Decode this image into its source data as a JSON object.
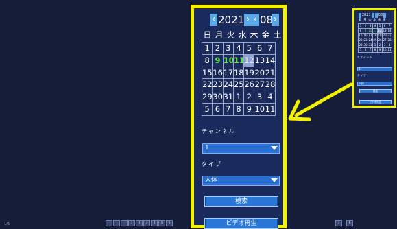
{
  "status": {
    "page_indicator": "1/6"
  },
  "bottom_nav": [
    "",
    "",
    "",
    "1",
    "2",
    "3",
    "4",
    "5",
    "6"
  ],
  "mini_nav": [
    "1",
    "6"
  ],
  "calendar": {
    "year": "2021",
    "month": "08",
    "weekdays": [
      "日",
      "月",
      "火",
      "水",
      "木",
      "金",
      "土"
    ],
    "weeks": [
      [
        "1",
        "2",
        "3",
        "4",
        "5",
        "6",
        "7"
      ],
      [
        "8",
        "9",
        "10",
        "11",
        "12",
        "13",
        "14"
      ],
      [
        "15",
        "16",
        "17",
        "18",
        "19",
        "20",
        "21"
      ],
      [
        "22",
        "23",
        "24",
        "25",
        "26",
        "27",
        "28"
      ],
      [
        "29",
        "30",
        "31",
        "1",
        "2",
        "3",
        "4"
      ],
      [
        "5",
        "6",
        "7",
        "8",
        "9",
        "10",
        "11"
      ]
    ],
    "recorded_days": [
      "9",
      "10",
      "11"
    ],
    "selected_day": "12"
  },
  "form": {
    "channel_label": "チャンネル",
    "channel_value": "1",
    "type_label": "タイプ",
    "type_value": "人体",
    "search_button": "検索",
    "play_button": "ビデオ再生"
  },
  "colors": {
    "highlight": "#f3f000",
    "accent": "#2a76d6",
    "recorded": "#66e84b"
  }
}
